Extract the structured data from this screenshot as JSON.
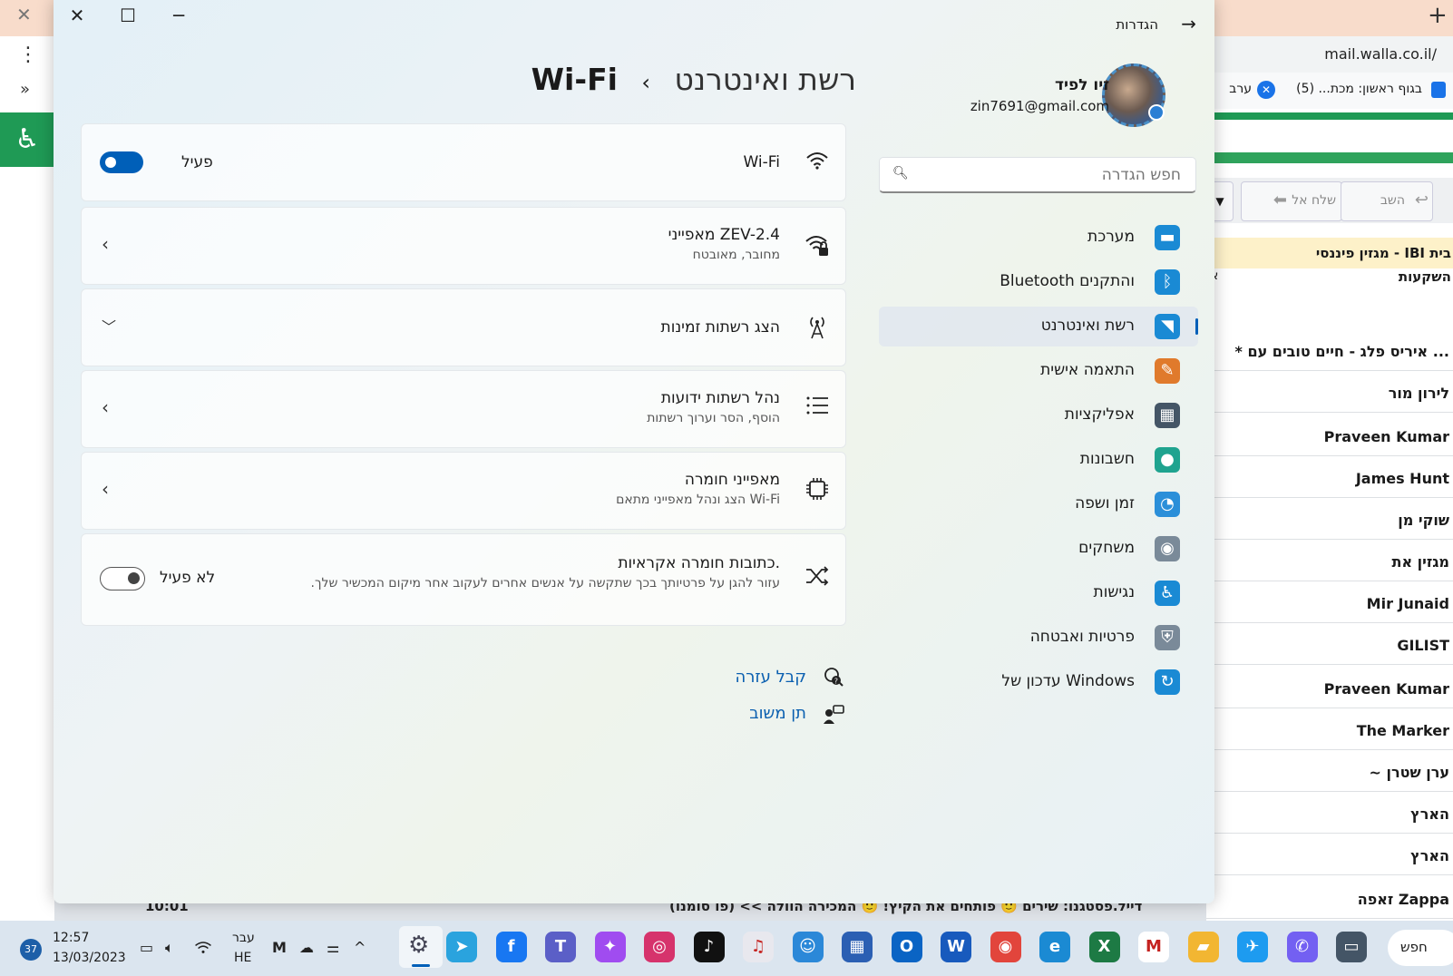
{
  "browser": {
    "url": "mail.walla.co.il/",
    "bookmarks": [
      "בגוף ראשון: מכת... (5)",
      "ערב"
    ],
    "reply_label": "השב",
    "forward_label": "שלח אל",
    "featured": {
      "title": "מגזין פיננסי - IBI בית",
      "subtitle": "השקעות",
      "extra": "א"
    },
    "mail_senders": [
      "* איריס פלג - חיים טובים עם ...",
      "לירון מור",
      "Praveen Kumar",
      "James Hunt",
      "שוקי מן",
      "מגזין את",
      "Mir Junaid",
      "GILIST",
      "Praveen Kumar",
      "The Marker",
      "~ ערן שטרן",
      "הארץ",
      "הארץ",
      "זאפה Zappa"
    ],
    "bottom_preview": "דייל.פסטגנו: שירים 🙂 פותחים את הקיץ! 🙂 המכירה הוולה >> (פו סומנו)",
    "bottom_time": "10:01"
  },
  "settings": {
    "app_title": "הגדרות",
    "user": {
      "name": "זיו לפיד",
      "email": "zin7691@gmail.com"
    },
    "search_placeholder": "חפש הגדרה",
    "nav": [
      {
        "label": "מערכת",
        "icon": "system-icon",
        "color": "#1a8ad4"
      },
      {
        "label": "Bluetooth והתקנים",
        "icon": "bluetooth-icon",
        "color": "#1a8ad4"
      },
      {
        "label": "רשת ואינטרנט",
        "icon": "wifi-icon",
        "color": "#1a8ad4"
      },
      {
        "label": "התאמה אישית",
        "icon": "brush-icon",
        "color": "#e07a2c"
      },
      {
        "label": "אפליקציות",
        "icon": "apps-icon",
        "color": "#445566"
      },
      {
        "label": "חשבונות",
        "icon": "account-icon",
        "color": "#1fa38f"
      },
      {
        "label": "זמן ושפה",
        "icon": "clock-globe-icon",
        "color": "#2b8fd9"
      },
      {
        "label": "משחקים",
        "icon": "gamepad-icon",
        "color": "#7a8a99"
      },
      {
        "label": "נגישות",
        "icon": "accessibility-icon",
        "color": "#1a8ad4"
      },
      {
        "label": "פרטיות ואבטחה",
        "icon": "shield-icon",
        "color": "#7a8a99"
      },
      {
        "label": "עדכון של Windows",
        "icon": "update-icon",
        "color": "#1a8ad4"
      }
    ],
    "breadcrumb": {
      "parent": "רשת ואינטרנט",
      "separator": "›",
      "current": "Wi-Fi"
    },
    "wifi": {
      "label": "Wi-Fi",
      "state": "פעיל"
    },
    "network": {
      "title": "מאפייני ZEV-2.4",
      "status": "מחובר, מאובטח"
    },
    "available": {
      "title": "הצג רשתות זמינות"
    },
    "known": {
      "title": "נהל רשתות ידועות",
      "sub": "הוסף, הסר וערוך רשתות"
    },
    "hardware": {
      "title": "מאפייני חומרה",
      "sub": "הצג ונהל מאפייני מתאם Wi-Fi"
    },
    "random_mac": {
      "title": "כתובות חומרה אקראיות.",
      "sub": "עזור להגן על פרטיותך בכך שתקשה על אנשים אחרים לעקוב אחר מיקום המכשיר שלך.",
      "state": "לא פעיל"
    },
    "help": {
      "get_help": "קבל עזרה",
      "feedback": "תן משוב"
    }
  },
  "taskbar": {
    "weather": "37",
    "time": "12:57",
    "date": "13/03/2023",
    "lang_top": "עבר",
    "lang_bottom": "HE",
    "search_label": "חפש",
    "accent": "#005fb8"
  }
}
